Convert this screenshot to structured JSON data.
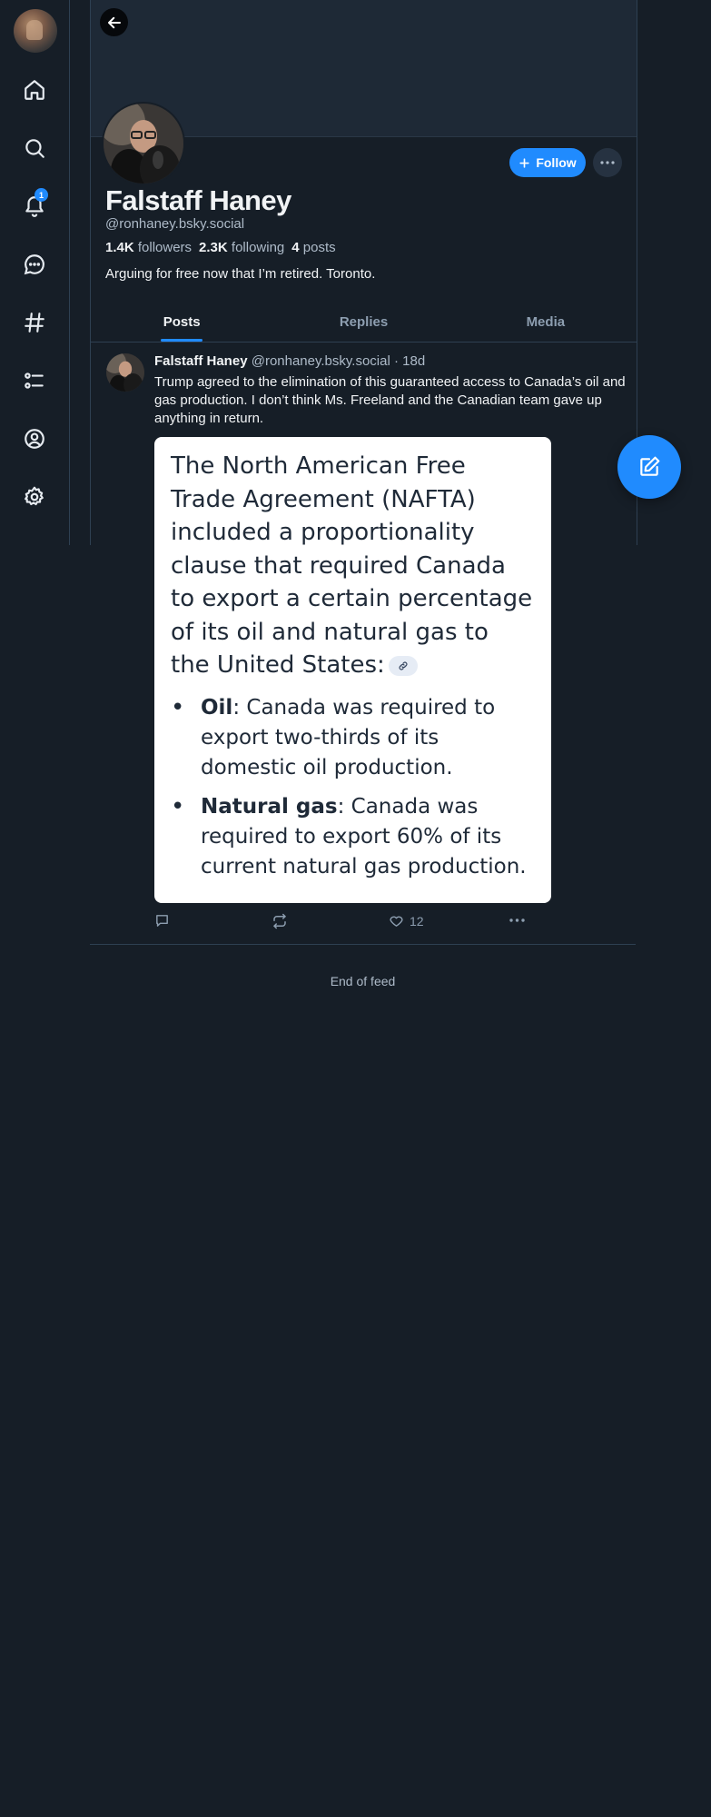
{
  "nav": {
    "notification_count": "1",
    "items": [
      "home-icon",
      "search-icon",
      "bell-icon",
      "chat-icon",
      "hashtag-icon",
      "list-icon",
      "profile-icon",
      "gear-icon"
    ]
  },
  "profile": {
    "display_name": "Falstaff Haney",
    "handle": "@ronhaney.bsky.social",
    "followers_count": "1.4K",
    "followers_label": "followers",
    "following_count": "2.3K",
    "following_label": "following",
    "posts_count": "4",
    "posts_label": "posts",
    "bio": "Arguing for free now that I’m retired. Toronto.",
    "follow_label": "Follow"
  },
  "tabs": [
    {
      "label": "Posts",
      "active": true
    },
    {
      "label": "Replies",
      "active": false
    },
    {
      "label": "Media",
      "active": false
    }
  ],
  "post": {
    "author": "Falstaff Haney",
    "handle": "@ronhaney.bsky.social",
    "separator": "·",
    "time": "18d",
    "text": "Trump agreed to the elimination of this guaranteed access to Canada’s oil and gas production. I don’t think Ms. Freeland and the Canadian team gave up anything in return.",
    "image": {
      "paragraph": "The North American Free Trade Agreement (NAFTA) included a proportionality clause that required Canada to export a certain percentage of its oil and natural gas to the United States:",
      "bullets": [
        {
          "term": "Oil",
          "text": ": Canada was required to export two-thirds of its domestic oil production."
        },
        {
          "term": "Natural gas",
          "text": ": Canada was required to export 60% of its current natural gas production."
        }
      ]
    },
    "like_count": "12"
  },
  "feed": {
    "end_text": "End of feed"
  },
  "colors": {
    "background": "#161e27",
    "accent": "#208bfe",
    "border": "#2e4052",
    "muted_text": "#aebbc9"
  }
}
